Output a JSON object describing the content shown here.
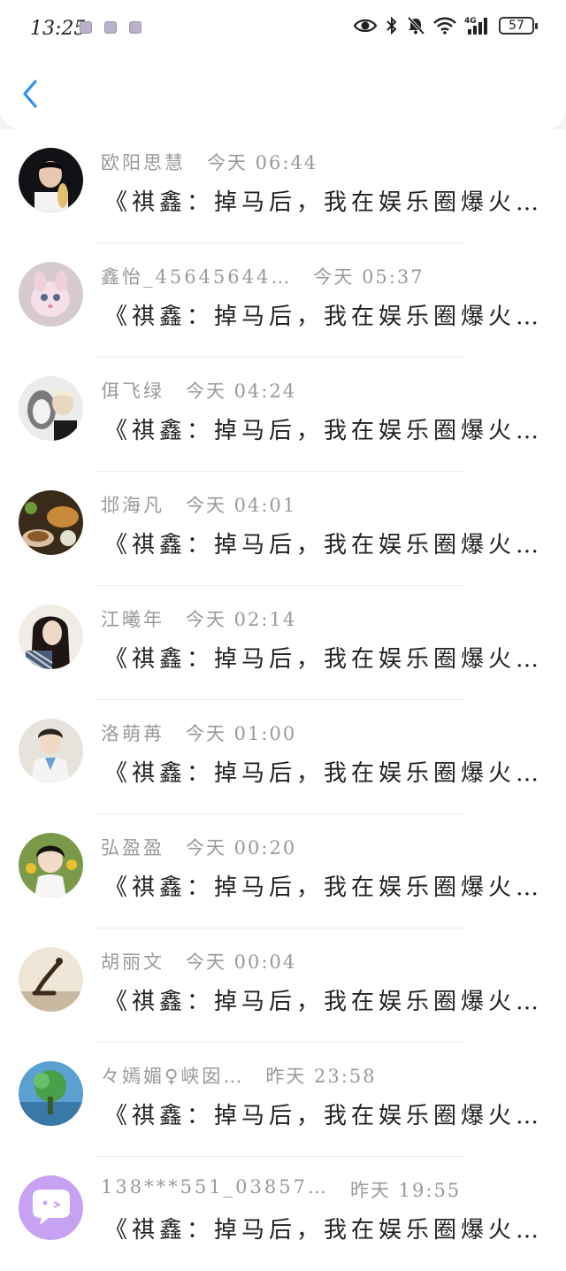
{
  "status_bar": {
    "time": "13:25",
    "battery": "57"
  },
  "header": {
    "back_icon": "chevron-left-icon"
  },
  "messages": [
    {
      "name": "欧阳思慧",
      "time": "今天 06:44",
      "preview": "《祺鑫：掉马后，我在娱乐圈爆火…",
      "avatar_color": "#1b1b22"
    },
    {
      "name": "鑫怡_45645644…",
      "time": "今天 05:37",
      "preview": "《祺鑫：掉马后，我在娱乐圈爆火…",
      "avatar_color": "#d9b6c4"
    },
    {
      "name": "佴飞绿",
      "time": "今天 04:24",
      "preview": "《祺鑫：掉马后，我在娱乐圈爆火…",
      "avatar_color": "#b8b8b8"
    },
    {
      "name": "邶海凡",
      "time": "今天 04:01",
      "preview": "《祺鑫：掉马后，我在娱乐圈爆火…",
      "avatar_color": "#7a4a22"
    },
    {
      "name": "江曦年",
      "time": "今天 02:14",
      "preview": "《祺鑫：掉马后，我在娱乐圈爆火…",
      "avatar_color": "#c9a896"
    },
    {
      "name": "洛萌苒",
      "time": "今天 01:00",
      "preview": "《祺鑫：掉马后，我在娱乐圈爆火…",
      "avatar_color": "#e8e4df"
    },
    {
      "name": "弘盈盈",
      "time": "今天 00:20",
      "preview": "《祺鑫：掉马后，我在娱乐圈爆火…",
      "avatar_color": "#5a7a3a"
    },
    {
      "name": "胡丽文",
      "time": "今天 00:04",
      "preview": "《祺鑫：掉马后，我在娱乐圈爆火…",
      "avatar_color": "#e6d6c2"
    },
    {
      "name": "々嫣媚♀峡囡…",
      "time": "昨天 23:58",
      "preview": "《祺鑫：掉马后，我在娱乐圈爆火…",
      "avatar_color": "#4a8fc0"
    },
    {
      "name": "138***551_03857…",
      "time": "昨天 19:55",
      "preview": "《祺鑫：掉马后，我在娱乐圈爆火…",
      "avatar_color": "#c9a0f0"
    }
  ]
}
